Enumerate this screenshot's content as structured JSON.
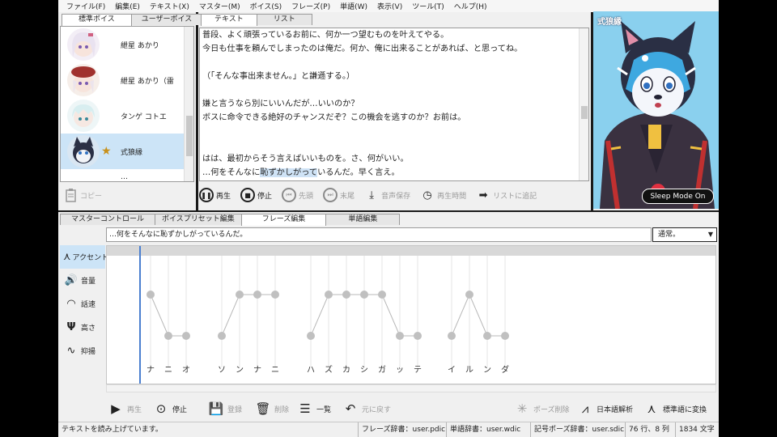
{
  "menu": [
    "ファイル(F)",
    "編集(E)",
    "テキスト(X)",
    "マスター(M)",
    "ボイス(S)",
    "フレーズ(P)",
    "単語(W)",
    "表示(V)",
    "ツール(T)",
    "ヘルプ(H)"
  ],
  "voice_tabs": [
    "標準ボイス",
    "ユーザーボイス"
  ],
  "voices": [
    {
      "name": "紲星 あかり"
    },
    {
      "name": "紲星 あかり（雷"
    },
    {
      "name": "タンゲ コトエ"
    },
    {
      "name": "式狼縁"
    },
    {
      "name": "…"
    }
  ],
  "copy_label": "コピー",
  "editor_tabs": [
    "テキスト",
    "リスト"
  ],
  "editor": {
    "lines": [
      "普段、よく頑張っているお前に、何か一つ望むものを叶えてやる。",
      "今日も仕事を頼んでしまったのは俺だ。何か、俺に出来ることがあれば、と思ってね。",
      "",
      "（「そんな事出来ません。」と謙遜する。）",
      "",
      "嫌と言うなら別にいいんだが…いいのか？",
      "ボスに命令できる絶好のチャンスだぞ？この機会を逃すのか？お前は。",
      "",
      "",
      "はは、最初からそう言えばいいものを。さ、何がいい。"
    ],
    "last_line_before": "…何をそんなに",
    "last_line_highlight": "恥ずかしがって",
    "last_line_after": "いるんだ。早く言え。"
  },
  "playback": {
    "play": "再生",
    "stop": "停止",
    "head": "先頭",
    "tail": "末尾",
    "save": "音声保存",
    "time": "再生時間",
    "add_list": "リストに追記"
  },
  "character": {
    "name": "式狼縁",
    "sleep_mode": "Sleep Mode On"
  },
  "lower_tabs": [
    "マスターコントロール",
    "ボイスプリセット編集",
    "フレーズ編集",
    "単語編集"
  ],
  "side_tools": [
    {
      "label": "アクセント",
      "icon": "accent-icon"
    },
    {
      "label": "音量",
      "icon": "speaker-icon"
    },
    {
      "label": "話速",
      "icon": "speedometer-icon"
    },
    {
      "label": "高さ",
      "icon": "tuning-fork-icon"
    },
    {
      "label": "抑揚",
      "icon": "waveform-icon"
    }
  ],
  "phrase_text": "…何をそんなに恥ずかしがっているんだ。",
  "style_value": "通常。",
  "accent": {
    "morae": [
      "ナ",
      "ニ",
      "オ",
      "ソ",
      "ン",
      "ナ",
      "ニ",
      "ハ",
      "ズ",
      "カ",
      "シ",
      "ガ",
      "ッ",
      "テ",
      "イ",
      "ル",
      "ン",
      "ダ"
    ],
    "levels": [
      1,
      0,
      0,
      0,
      1,
      1,
      1,
      0,
      1,
      1,
      1,
      1,
      0,
      0,
      0,
      1,
      0,
      0
    ],
    "groups": [
      [
        0,
        2
      ],
      [
        3,
        6
      ],
      [
        7,
        13
      ],
      [
        14,
        17
      ]
    ]
  },
  "bottom_toolbar": {
    "play": "再生",
    "stop": "停止",
    "register": "登録",
    "delete": "削除",
    "list": "一覧",
    "revert": "元に戻す",
    "pause_delete": "ポーズ削除",
    "jp_analysis": "日本語解析",
    "to_standard": "標準語に変換"
  },
  "status": {
    "message": "テキストを読み上げています。",
    "phrase_dict": "フレーズ辞書：user.pdic",
    "word_dict": "単語辞書：user.wdic",
    "symbol_dict": "記号ポーズ辞書：user.sdic",
    "position": "76 行、8 列",
    "chars": "1834 文字"
  },
  "colors": {
    "selection": "#cce4f7",
    "accent_line": "#4a7fd0",
    "point": "#c0c0c0",
    "character_bg": "#8ad0ee"
  }
}
